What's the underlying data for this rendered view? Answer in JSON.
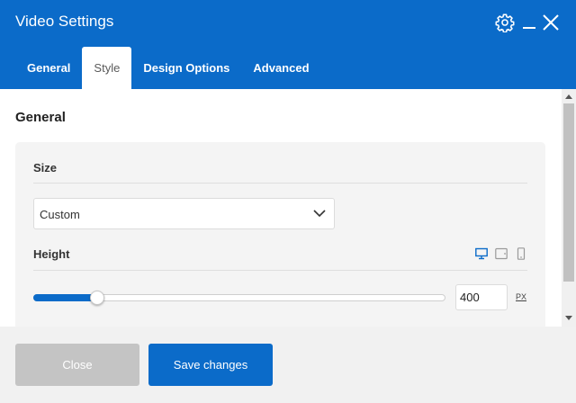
{
  "header": {
    "title": "Video Settings",
    "icons": [
      "gear-icon",
      "minimize-icon",
      "close-icon"
    ],
    "accent_color": "#0b6bc9"
  },
  "tabs": [
    {
      "label": "General",
      "active": false
    },
    {
      "label": "Style",
      "active": true
    },
    {
      "label": "Design Options",
      "active": false
    },
    {
      "label": "Advanced",
      "active": false
    }
  ],
  "content": {
    "section_title": "General",
    "size": {
      "label": "Size",
      "selected": "Custom"
    },
    "height": {
      "label": "Height",
      "devices": [
        "desktop-icon",
        "tablet-icon",
        "mobile-icon"
      ],
      "active_device": "desktop",
      "slider_fraction": 0.155,
      "value": "400",
      "unit": "PX"
    }
  },
  "footer": {
    "close_label": "Close",
    "save_label": "Save changes"
  }
}
